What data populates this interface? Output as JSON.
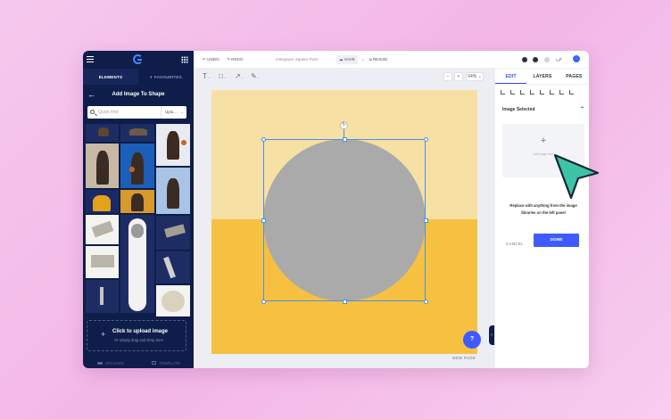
{
  "left_panel": {
    "tabs": [
      {
        "label": "ELEMENTS",
        "active": true
      },
      {
        "label": "FAVOURITES",
        "active": false
      }
    ],
    "title": "Add Image To Shape",
    "search_placeholder": "Quick find",
    "upload_select": "Uplo...",
    "upload_card": {
      "title": "Click to upload image",
      "subtitle": "Or simply drag and Drop here"
    },
    "bottom_tabs": [
      "UPLOADS",
      "TEMPLATE"
    ]
  },
  "toolbar": {
    "undo": "UNDO",
    "redo": "REDO",
    "doc_title": "Instagram Square Post",
    "save": "SAVE",
    "resize": "RESIZE"
  },
  "canvas": {
    "zoom": "64%",
    "zoom_minus": "−",
    "zoom_plus": "+",
    "new_page": "NEW PAGE",
    "help": "?",
    "colors": {
      "top": "#f6e0a3",
      "bottom": "#f6c141",
      "shape": "#aaaaaa",
      "selection": "#4a90e2"
    }
  },
  "right_panel": {
    "tabs": [
      {
        "label": "EDIT",
        "active": true
      },
      {
        "label": "LAYERS",
        "active": false
      },
      {
        "label": "PAGES",
        "active": false
      }
    ],
    "section_title": "Image Selected",
    "placeholder_label": "Add image here",
    "replace_text": "Replace with anything from the image libraries on the left panel",
    "cancel": "CANCEL",
    "done": "DONE"
  },
  "colors": {
    "accent": "#3f5bff",
    "panel": "#0f1d4a",
    "cursor": "#3bc5a6"
  }
}
